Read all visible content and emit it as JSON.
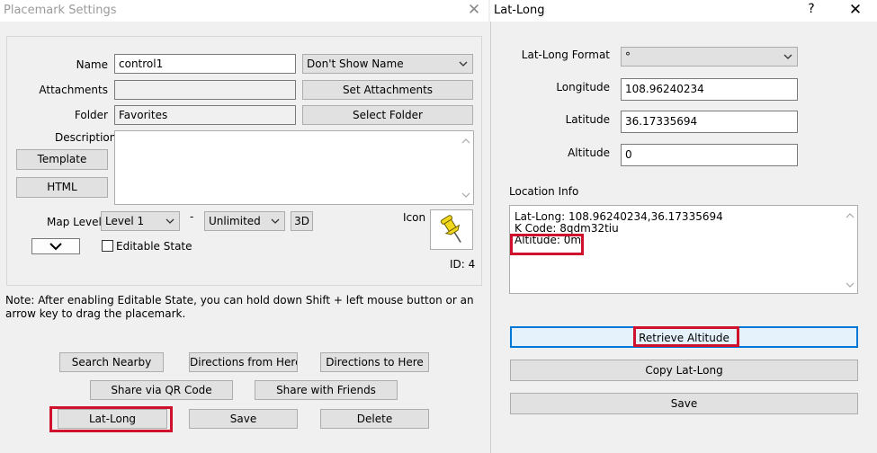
{
  "placemark": {
    "title": "Placemark Settings",
    "close_glyph": "✕",
    "name": {
      "label": "Name",
      "value": "control1"
    },
    "name_display": {
      "selected": "Don't Show Name"
    },
    "attachments": {
      "label": "Attachments",
      "value": "",
      "button": "Set Attachments"
    },
    "folder": {
      "label": "Folder",
      "value": "Favorites",
      "button": "Select Folder"
    },
    "description": {
      "label": "Description",
      "value": ""
    },
    "template_button": "Template",
    "html_button": "HTML",
    "map_level": {
      "label": "Map Level",
      "from": "Level 1",
      "separator": "-",
      "to": "Unlimited",
      "button_3d": "3D"
    },
    "editable_state": {
      "label": "Editable State",
      "checked": false
    },
    "icon": {
      "label": "Icon",
      "name": "pushpin-icon",
      "color": "#f2d81c"
    },
    "id_text": "ID: 4",
    "note": "Note: After enabling Editable State, you can hold down Shift + left mouse button or an arrow key to drag the placemark.",
    "buttons": {
      "search_nearby": "Search Nearby",
      "directions_from": "Directions from Here",
      "directions_to": "Directions to Here",
      "share_qr": "Share via QR Code",
      "share_friends": "Share with Friends",
      "lat_long": "Lat-Long",
      "save": "Save",
      "delete": "Delete"
    }
  },
  "latlong": {
    "title": "Lat-Long",
    "help_glyph": "?",
    "close_glyph": "✕",
    "format": {
      "label": "Lat-Long Format",
      "selected": "°"
    },
    "longitude": {
      "label": "Longitude",
      "value": "108.96240234"
    },
    "latitude": {
      "label": "Latitude",
      "value": "36.17335694"
    },
    "altitude": {
      "label": "Altitude",
      "value": "0"
    },
    "location_info": {
      "label": "Location Info",
      "line1": "Lat-Long: 108.96240234,36.17335694",
      "line2": "K Code: 8qdm32tiu",
      "line3": "Altitude: 0m"
    },
    "buttons": {
      "retrieve_altitude": "Retrieve Altitude",
      "copy_latlong": "Copy Lat-Long",
      "save": "Save"
    }
  },
  "colors": {
    "highlight": "#d0112b",
    "focus_border": "#0078d7",
    "focus_fill": "#e5f1fb"
  }
}
